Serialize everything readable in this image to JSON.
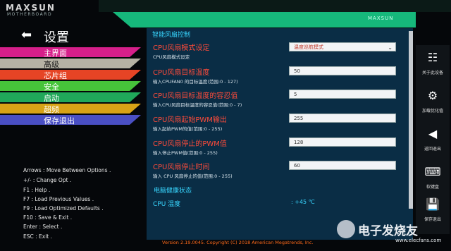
{
  "brand": {
    "name": "MAXSUN",
    "sub": "MOTHERBOARD",
    "badge": "MAXSUN"
  },
  "menu": {
    "title": "设置",
    "items": [
      {
        "label": "主界面",
        "color": "#d61f8a"
      },
      {
        "label": "高级",
        "color": "#b6b2a4",
        "active": true
      },
      {
        "label": "芯片组",
        "color": "#e64425"
      },
      {
        "label": "安全",
        "color": "#46c33a"
      },
      {
        "label": "启动",
        "color": "#20a85a"
      },
      {
        "label": "超频",
        "color": "#d8a316"
      },
      {
        "label": "保存退出",
        "color": "#4a4fc4"
      }
    ]
  },
  "help": [
    "Arrows : Move Between Options .",
    "+/- : Change Opt .",
    "F1 : Help .",
    "F7 : Load Previous Values .",
    "F9 : Load Optimized Defaults .",
    "F10 : Save & Exit .",
    "Enter : Select .",
    "ESC : Exit ."
  ],
  "panel": {
    "section_title": "智能风扇控制",
    "options": [
      {
        "label": "CPU风扇模式设定",
        "help": "CPU风扇模式设定",
        "value": "温度巡航模式",
        "type": "select"
      },
      {
        "label": "CPU风扇目标温度",
        "help": "输入CPUFAN0 的目标温度(范围:0 - 127)",
        "value": "50",
        "type": "input"
      },
      {
        "label": "CPU风扇目标温度的容忍值",
        "help": "输入CPU风扇目标温度的容忍值(范围:0 - 7)",
        "value": "5",
        "type": "input"
      },
      {
        "label": "CPU风扇起始PWM输出",
        "help": "输入起始PWM的值(范围:0 - 255)",
        "value": "255",
        "type": "input"
      },
      {
        "label": "CPU风扇停止的PWM值",
        "help": "输入停止PWM值(范围:0 - 255)",
        "value": "128",
        "type": "input"
      },
      {
        "label": "CPU风扇停止时间",
        "help": "输入 CPU 风扇停止的值(范围:0 - 255)",
        "value": "60",
        "type": "input"
      }
    ],
    "health_title": "电脑健康状态",
    "cpu_temp_label": "CPU 温度",
    "cpu_temp_value": ": +45 ℃"
  },
  "tools": [
    {
      "icon": "sliders-icon",
      "glyph": "☷",
      "label": "关于此设备"
    },
    {
      "icon": "gear-icon",
      "glyph": "⚙",
      "label": "加载优化值"
    },
    {
      "icon": "back-icon",
      "glyph": "◀",
      "label": "返回退出"
    },
    {
      "icon": "keyboard-icon",
      "glyph": "⌨",
      "label": "软键盘"
    },
    {
      "icon": "save-icon",
      "glyph": "💾",
      "label": "保存退出"
    }
  ],
  "version": "Version 2.19.0045. Copyright (C) 2018 American Megatrends, Inc.",
  "watermark": {
    "text": "电子发烧友",
    "url": "www.elecfans.com"
  }
}
